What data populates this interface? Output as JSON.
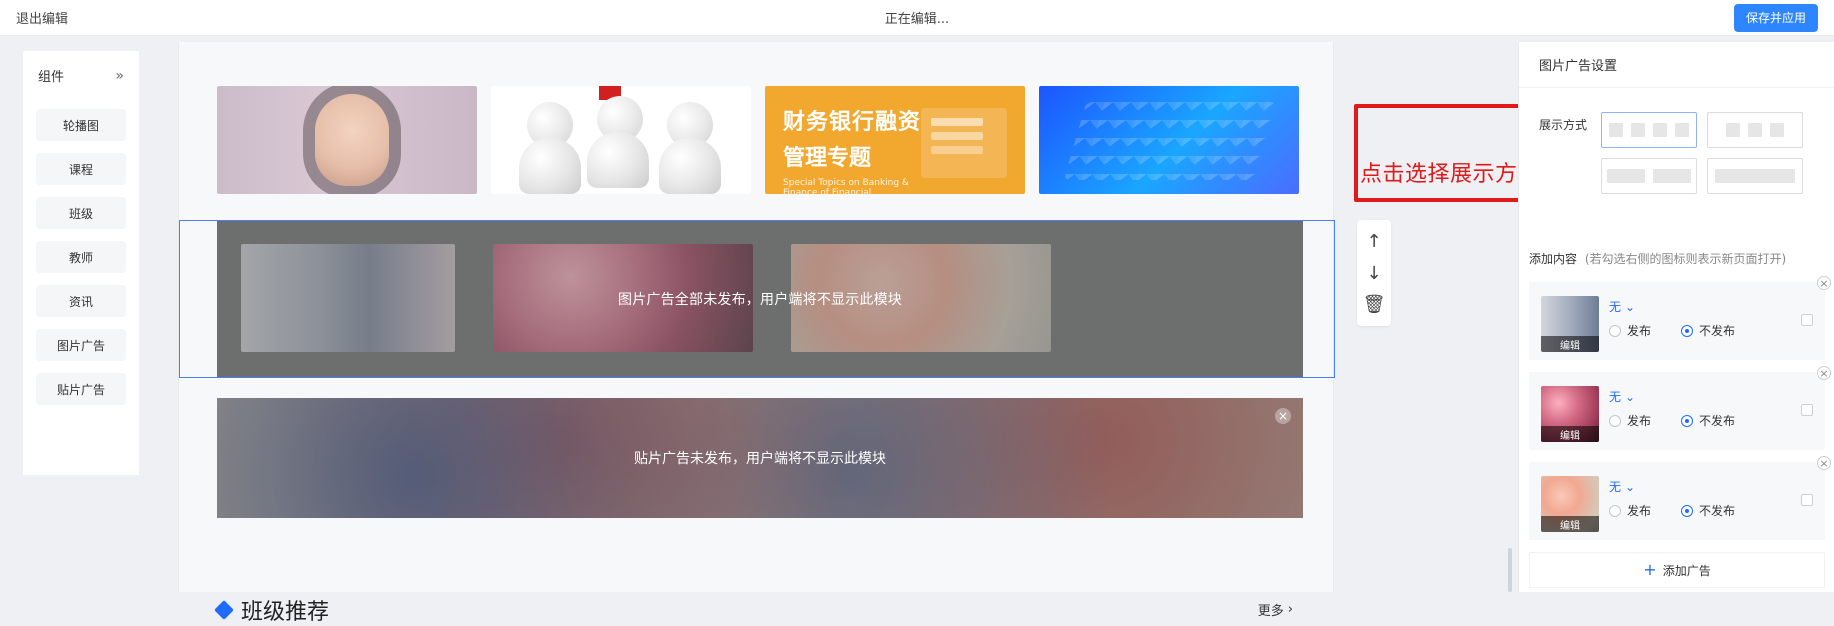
{
  "topbar": {
    "exit_label": "退出编辑",
    "editing_label": "正在编辑...",
    "save_label": "保存并应用"
  },
  "sidebar": {
    "title": "组件",
    "collapse_icon": "double-chevron-right-icon",
    "items": [
      {
        "label": "轮播图"
      },
      {
        "label": "课程"
      },
      {
        "label": "班级"
      },
      {
        "label": "教师"
      },
      {
        "label": "资讯"
      },
      {
        "label": "图片广告"
      },
      {
        "label": "贴片广告"
      }
    ]
  },
  "canvas": {
    "banners": [
      {
        "kind": "portrait"
      },
      {
        "kind": "3d-people"
      },
      {
        "kind": "finance",
        "line1": "财务银行融资",
        "line2": "管理专题",
        "line3": "Special Topics on Banking & Finance of Financial Institutions"
      },
      {
        "kind": "isometric-city"
      }
    ],
    "image_ad_module": {
      "overlay_text": "图片广告全部未发布，用户端将不显示此模块"
    },
    "paste_ad_module": {
      "overlay_text": "贴片广告未发布，用户端将不显示此模块",
      "close_icon": "close-icon"
    },
    "section": {
      "title": "班级推荐",
      "more_label": "更多",
      "more_icon": "chevron-right-icon"
    },
    "ops": {
      "up_icon": "arrow-up-icon",
      "down_icon": "arrow-down-icon",
      "delete_icon": "trash-icon"
    }
  },
  "annotation": {
    "text": "点击选择展示方式",
    "color": "#e11919"
  },
  "right_panel": {
    "title": "图片广告设置",
    "display_label": "展示方式",
    "add_content_label": "添加内容",
    "add_content_hint": "(若勾选右侧的图标则表示新页面打开)",
    "cards": [
      {
        "thumb_kind": "dress",
        "link_value": "无",
        "publish_label": "发布",
        "unpublish_label": "不发布",
        "selected": "unpublish"
      },
      {
        "thumb_kind": "roses",
        "link_value": "无",
        "publish_label": "发布",
        "unpublish_label": "不发布",
        "selected": "unpublish"
      },
      {
        "thumb_kind": "flower",
        "link_value": "无",
        "publish_label": "发布",
        "unpublish_label": "不发布",
        "selected": "unpublish"
      }
    ],
    "edit_label": "编辑",
    "add_ad_label": "添加广告",
    "add_ad_icon": "plus-icon"
  },
  "colors": {
    "primary": "#2d86ff",
    "selection": "#4b7dff",
    "annotation_red": "#e11919"
  }
}
